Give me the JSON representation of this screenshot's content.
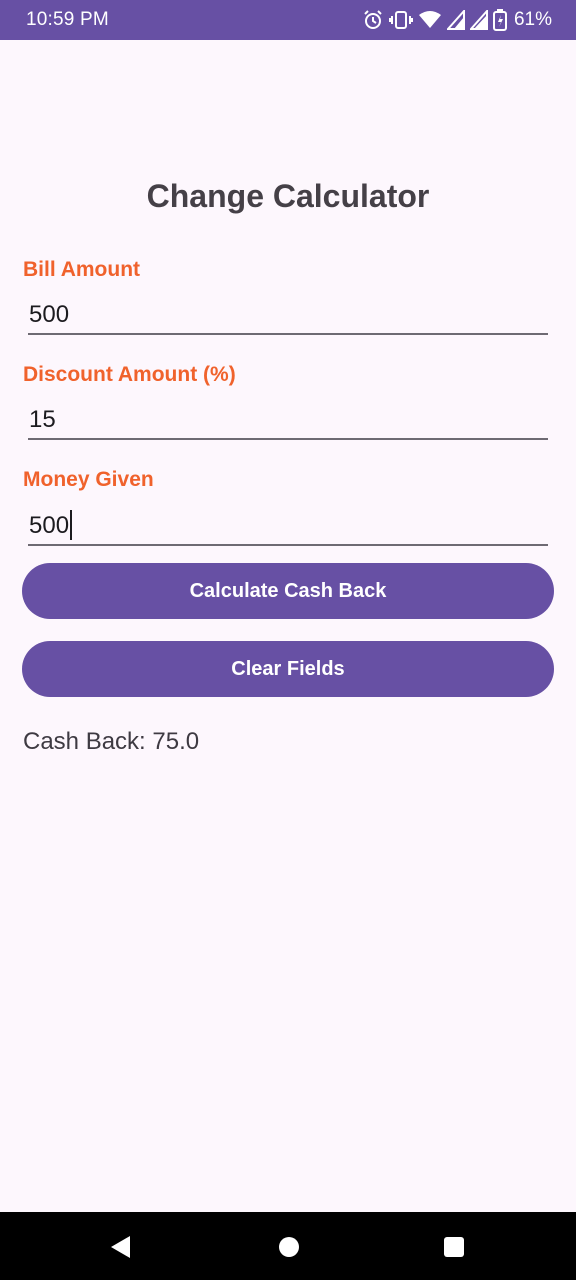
{
  "status_bar": {
    "time": "10:59 PM",
    "battery_percent": "61%",
    "icons": [
      "alarm-icon",
      "vibrate-icon",
      "wifi-icon",
      "signal-icon",
      "signal-icon",
      "battery-icon"
    ]
  },
  "app": {
    "title": "Change Calculator"
  },
  "form": {
    "bill_amount": {
      "label": "Bill Amount",
      "value": "500"
    },
    "discount_amount": {
      "label": "Discount Amount (%)",
      "value": "15"
    },
    "money_given": {
      "label": "Money Given",
      "value": "500"
    }
  },
  "buttons": {
    "calculate_label": "Calculate Cash Back",
    "clear_label": "Clear Fields"
  },
  "result": {
    "text": "Cash Back: 75.0"
  },
  "nav_bar": {
    "icons": [
      "back-icon",
      "home-icon",
      "recents-icon"
    ]
  },
  "colors": {
    "primary": "#6750a4",
    "label": "#f0622c",
    "background": "#fdf7fd"
  }
}
